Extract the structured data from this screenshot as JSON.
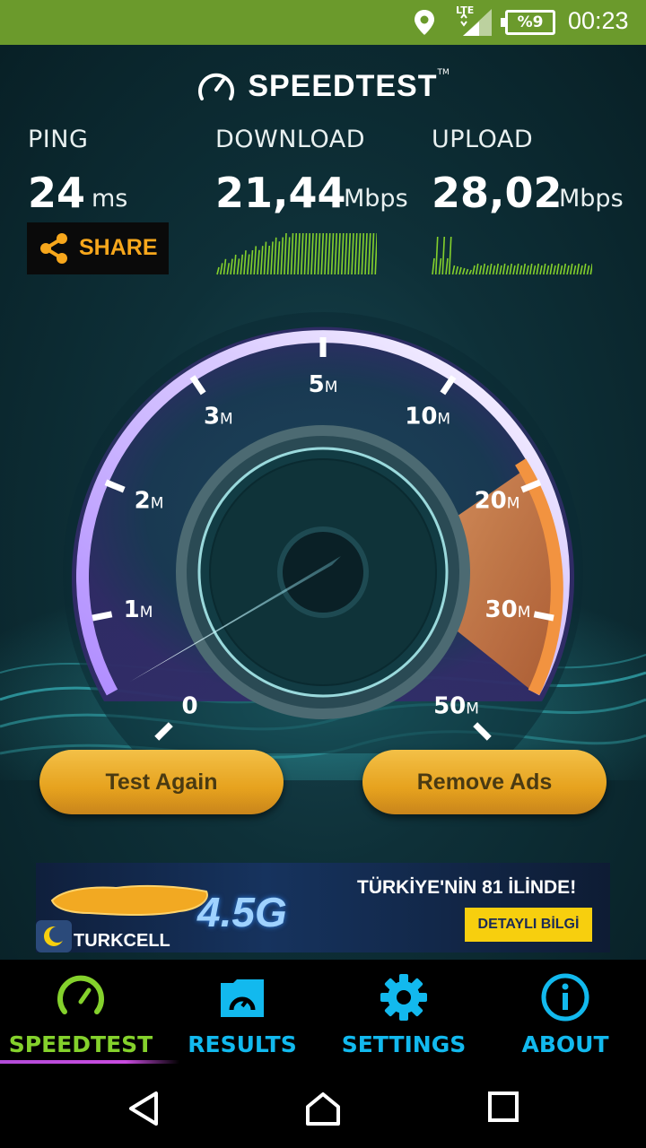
{
  "status_bar": {
    "network": "LTE",
    "battery": "%9",
    "time": "00:23",
    "icons": [
      "location-icon",
      "signal-icon",
      "battery-icon"
    ]
  },
  "app": {
    "brand": "SPEEDTEST",
    "trademark": "TM",
    "ping": {
      "label": "PING",
      "value": "24",
      "unit": "ms"
    },
    "download": {
      "label": "DOWNLOAD",
      "value": "21,44",
      "unit": "Mbps"
    },
    "upload": {
      "label": "UPLOAD",
      "value": "28,02",
      "unit": "Mbps"
    },
    "share_label": "SHARE",
    "gauge": {
      "ticks": [
        {
          "n": "0",
          "u": ""
        },
        {
          "n": "1",
          "u": "M"
        },
        {
          "n": "2",
          "u": "M"
        },
        {
          "n": "3",
          "u": "M"
        },
        {
          "n": "5",
          "u": "M"
        },
        {
          "n": "10",
          "u": "M"
        },
        {
          "n": "20",
          "u": "M"
        },
        {
          "n": "30",
          "u": "M"
        },
        {
          "n": "50",
          "u": "M"
        }
      ],
      "needle_fraction": 0.0
    },
    "test_again_label": "Test Again",
    "remove_ads_label": "Remove Ads"
  },
  "ad": {
    "headline": "TÜRKİYE'NİN 81 İLİNDE!",
    "cta": "DETAYLI BİLGİ",
    "product": "4.5G",
    "brand": "TURKCELL"
  },
  "bottom_nav": [
    {
      "label": "SPEEDTEST",
      "icon": "speedometer-icon",
      "active": true
    },
    {
      "label": "RESULTS",
      "icon": "results-folder-icon",
      "active": false
    },
    {
      "label": "SETTINGS",
      "icon": "gear-icon",
      "active": false
    },
    {
      "label": "ABOUT",
      "icon": "info-icon",
      "active": false
    }
  ],
  "colors": {
    "status_bar": "#6b9a2c",
    "accent_green": "#84d12c",
    "accent_blue": "#12b9ee",
    "share_orange": "#f7a71c",
    "button_gold": "#e6a21e"
  }
}
